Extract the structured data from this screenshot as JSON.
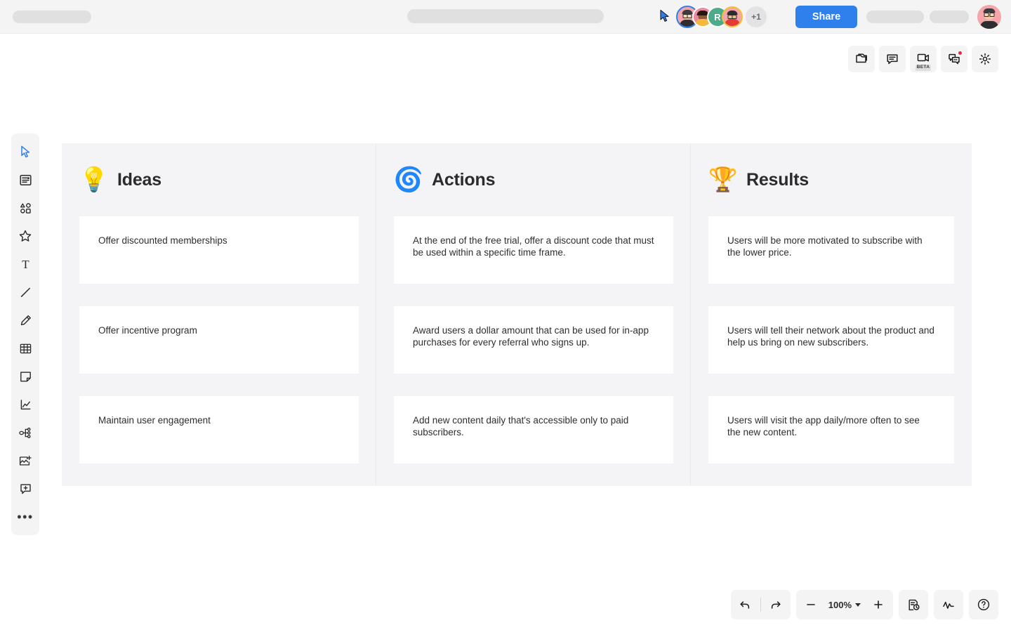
{
  "topbar": {
    "share_label": "Share",
    "collaborators": [
      {
        "name": "active-user-avatar",
        "type": "photo",
        "bg": "#f6a5a8",
        "ring": "#2f80ed"
      },
      {
        "name": "collaborator-avatar-1",
        "type": "photo",
        "bg": "#e98aa0",
        "ring": "#e98aa0"
      },
      {
        "name": "collaborator-avatar-2",
        "type": "initial",
        "initial": "R",
        "bg": "#4bab8a",
        "ring": "#4bab8a"
      },
      {
        "name": "collaborator-avatar-3",
        "type": "photo",
        "bg": "#f6a5a8",
        "ring": "#f2c13c"
      }
    ],
    "overflow_count": "+1",
    "cursor_icon": "pointer-cursor-icon",
    "me_avatar": "current-user-avatar"
  },
  "top_right_toolbar": {
    "items": [
      {
        "name": "pages-icon",
        "label": "Pages"
      },
      {
        "name": "comment-icon",
        "label": "Comments"
      },
      {
        "name": "video-camera-icon",
        "label": "Video Chat",
        "tag": "BETA"
      },
      {
        "name": "chat-icon",
        "label": "Chat",
        "badge": true
      },
      {
        "name": "gear-icon",
        "label": "Settings"
      }
    ],
    "beta_tag": "BETA"
  },
  "left_toolbar": {
    "items": [
      {
        "name": "select-cursor-icon",
        "label": "Select",
        "active": true
      },
      {
        "name": "template-icon",
        "label": "Templates"
      },
      {
        "name": "shapes-icon",
        "label": "Shapes"
      },
      {
        "name": "star-icon",
        "label": "Star"
      },
      {
        "name": "text-icon",
        "label": "Text"
      },
      {
        "name": "line-icon",
        "label": "Line"
      },
      {
        "name": "pen-icon",
        "label": "Pen"
      },
      {
        "name": "table-icon",
        "label": "Table"
      },
      {
        "name": "sticky-note-icon",
        "label": "Sticky Note"
      },
      {
        "name": "chart-icon",
        "label": "Chart"
      },
      {
        "name": "mindmap-icon",
        "label": "Mind Map"
      },
      {
        "name": "add-image-icon",
        "label": "Add Image"
      },
      {
        "name": "add-comment-icon",
        "label": "Add Comment"
      },
      {
        "name": "more-tools-icon",
        "label": "More"
      }
    ],
    "more_glyph": "•••"
  },
  "board": {
    "columns": [
      {
        "emoji": "💡",
        "emoji_name": "lightbulb-emoji",
        "title": "Ideas"
      },
      {
        "emoji": "🌀",
        "emoji_name": "cyclone-emoji",
        "title": "Actions"
      },
      {
        "emoji": "🏆",
        "emoji_name": "trophy-emoji",
        "title": "Results"
      }
    ],
    "rows": [
      {
        "ideas": "Offer discounted memberships",
        "actions": "At the end of the free trial, offer a discount code that must be used within a specific time frame.",
        "results": "Users will be more motivated to subscribe with the lower price."
      },
      {
        "ideas": "Offer incentive program",
        "actions": "Award users a dollar amount that can be used for in-app purchases for every referral who signs up.",
        "results": "Users will tell their network about the product and help us bring on new subscribers."
      },
      {
        "ideas": "Maintain user engagement",
        "actions": "Add new content daily that's accessible only to paid subscribers.",
        "results": "Users will visit the app daily/more often to see the new content."
      }
    ]
  },
  "bottom_toolbar": {
    "undo": "undo-icon",
    "redo": "redo-icon",
    "zoom_out": "−",
    "zoom_level": "100%",
    "zoom_in": "+",
    "history_icon": "version-history-icon",
    "activity_icon": "activity-pulse-icon",
    "help_icon": "help-circle-icon"
  },
  "colors": {
    "accent": "#2f80ed",
    "panel": "#f4f4f5",
    "canvas_grid": "#f4f4f6",
    "card": "#ffffff",
    "text": "#2e2e31",
    "badge": "#f0253f"
  }
}
